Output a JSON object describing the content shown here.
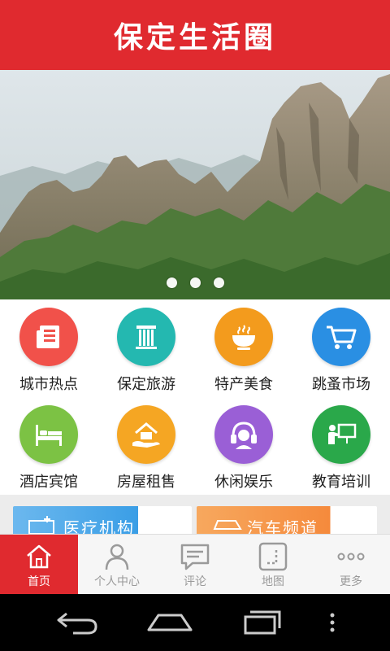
{
  "header": {
    "title": "保定生活圈"
  },
  "banner": {
    "slides": 3,
    "active_slide": 0
  },
  "categories": [
    {
      "label": "城市热点",
      "icon": "newspaper-icon",
      "color": "#f1514a"
    },
    {
      "label": "保定旅游",
      "icon": "pillar-icon",
      "color": "#24b8b0"
    },
    {
      "label": "特产美食",
      "icon": "bowl-icon",
      "color": "#f39b1d"
    },
    {
      "label": "跳蚤市场",
      "icon": "cart-icon",
      "color": "#2a8fe3"
    },
    {
      "label": "酒店宾馆",
      "icon": "bed-icon",
      "color": "#7cc244"
    },
    {
      "label": "房屋租售",
      "icon": "house-hand-icon",
      "color": "#f5a623"
    },
    {
      "label": "休闲娱乐",
      "icon": "headphones-icon",
      "color": "#9a5fd6"
    },
    {
      "label": "教育培训",
      "icon": "teacher-icon",
      "color": "#2aa84a"
    }
  ],
  "cards": [
    {
      "label": "医疗机构",
      "color": "#3a9ee6"
    },
    {
      "label": "汽车频道",
      "color": "#f58a3c"
    }
  ],
  "tabs": [
    {
      "label": "首页",
      "icon": "home-icon"
    },
    {
      "label": "个人中心",
      "icon": "person-icon"
    },
    {
      "label": "评论",
      "icon": "comment-icon"
    },
    {
      "label": "地图",
      "icon": "map-icon"
    },
    {
      "label": "更多",
      "icon": "more-icon"
    }
  ],
  "active_tab": "首页"
}
